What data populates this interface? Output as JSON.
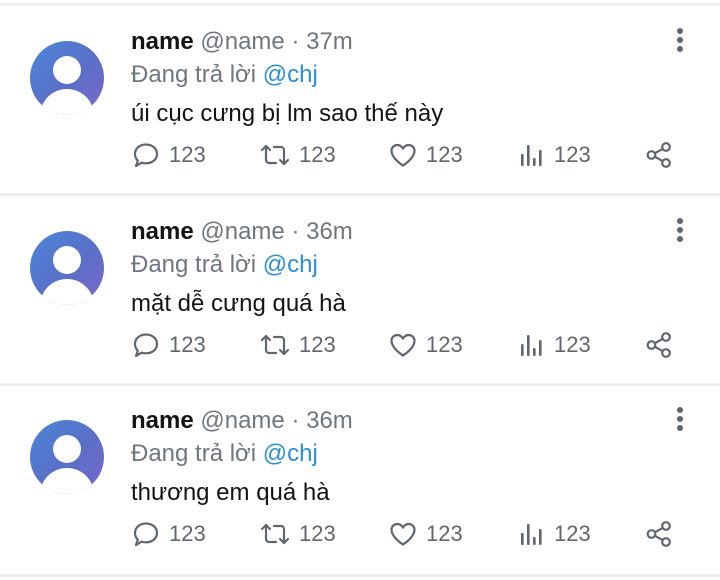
{
  "tweets": [
    {
      "name": "name",
      "handle": "@name",
      "time": "· 37m",
      "reply_prefix": "Đang trả lời",
      "mention": "@chj",
      "text": "úi cục cưng bị lm sao thế này",
      "counts": {
        "replies": "123",
        "retweets": "123",
        "likes": "123",
        "views": "123"
      }
    },
    {
      "name": "name",
      "handle": "@name",
      "time": "· 36m",
      "reply_prefix": "Đang trả lời",
      "mention": "@chj",
      "text": "mặt dễ cưng quá hà",
      "counts": {
        "replies": "123",
        "retweets": "123",
        "likes": "123",
        "views": "123"
      }
    },
    {
      "name": "name",
      "handle": "@name",
      "time": "· 36m",
      "reply_prefix": "Đang trả lời",
      "mention": "@chj",
      "text": "thương em quá hà",
      "counts": {
        "replies": "123",
        "retweets": "123",
        "likes": "123",
        "views": "123"
      }
    }
  ],
  "icons": {
    "reply": "speech-bubble-icon",
    "retweet": "retweet-icon",
    "like": "heart-icon",
    "views": "bar-chart-icon",
    "share": "share-icon",
    "more": "vertical-dots-icon"
  },
  "colors": {
    "mention": "#2b8fd6",
    "muted": "#6e7681",
    "divider": "#eef0f2",
    "avatar_start": "#4a86d8",
    "avatar_end": "#7a66c8"
  }
}
